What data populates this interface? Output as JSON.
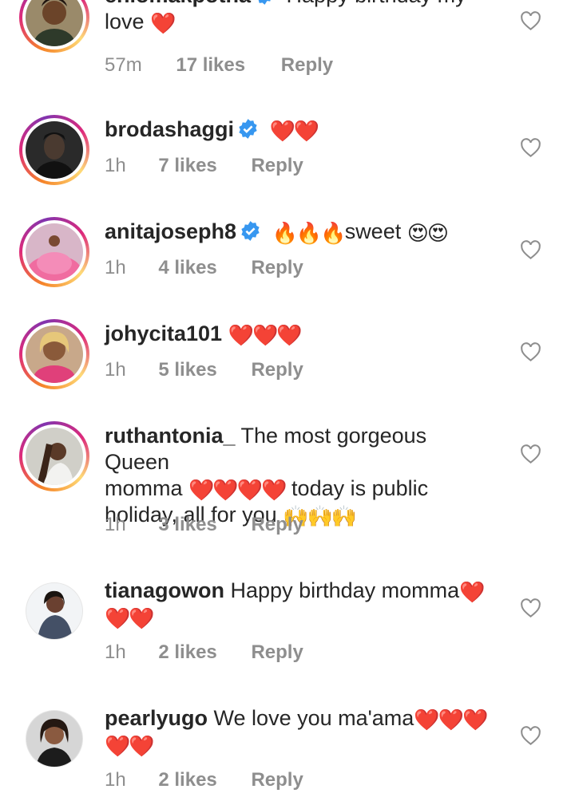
{
  "colors": {
    "verified": "#3797f0",
    "heart": "#e0182d",
    "meta": "#8e8e8e"
  },
  "comments": [
    {
      "username": "chiomakpotha",
      "verified": true,
      "text": "Happy birthday my",
      "text2": "love",
      "emoji": "❤️",
      "time": "57m",
      "likes": "17 likes",
      "reply": "Reply",
      "avatar": "avatar-woman-smiling"
    },
    {
      "username": "brodashaggi",
      "verified": true,
      "text": "",
      "emoji": "❤️❤️",
      "time": "1h",
      "likes": "7 likes",
      "reply": "Reply",
      "avatar": "avatar-man-portrait"
    },
    {
      "username": "anitajoseph8",
      "verified": true,
      "text_pre_emoji": "🔥🔥🔥",
      "text": "sweet",
      "emoji": "😍😍",
      "time": "1h",
      "likes": "4 likes",
      "reply": "Reply",
      "avatar": "avatar-pink-gown"
    },
    {
      "username": "johycita101",
      "verified": false,
      "text": "",
      "emoji": "❤️❤️❤️",
      "time": "1h",
      "likes": "5 likes",
      "reply": "Reply",
      "avatar": "avatar-woman-pink"
    },
    {
      "username": "ruthantonia_",
      "verified": false,
      "text": "The most gorgeous Queen",
      "line2a": "momma",
      "line2_emoji": "❤️❤️❤️❤️",
      "line2b": "today is public",
      "line3": "holiday, all for you",
      "line3_emoji": "🙌🙌🙌",
      "time": "1h",
      "likes": "3 likes",
      "reply": "Reply",
      "avatar": "avatar-woman-braids"
    },
    {
      "username": "tianagowon",
      "verified": false,
      "text": "Happy birthday momma",
      "emoji": "❤️",
      "line2_emoji": "❤️❤️",
      "time": "1h",
      "likes": "2 likes",
      "reply": "Reply",
      "avatar": "avatar-woman-blazer"
    },
    {
      "username": "pearlyugo",
      "verified": false,
      "text": "We love you ma'ama",
      "emoji": "❤️❤️❤️",
      "line2_emoji": "❤️❤️",
      "time": "1h",
      "likes": "2 likes",
      "reply": "Reply",
      "avatar": "avatar-woman-glam"
    }
  ]
}
